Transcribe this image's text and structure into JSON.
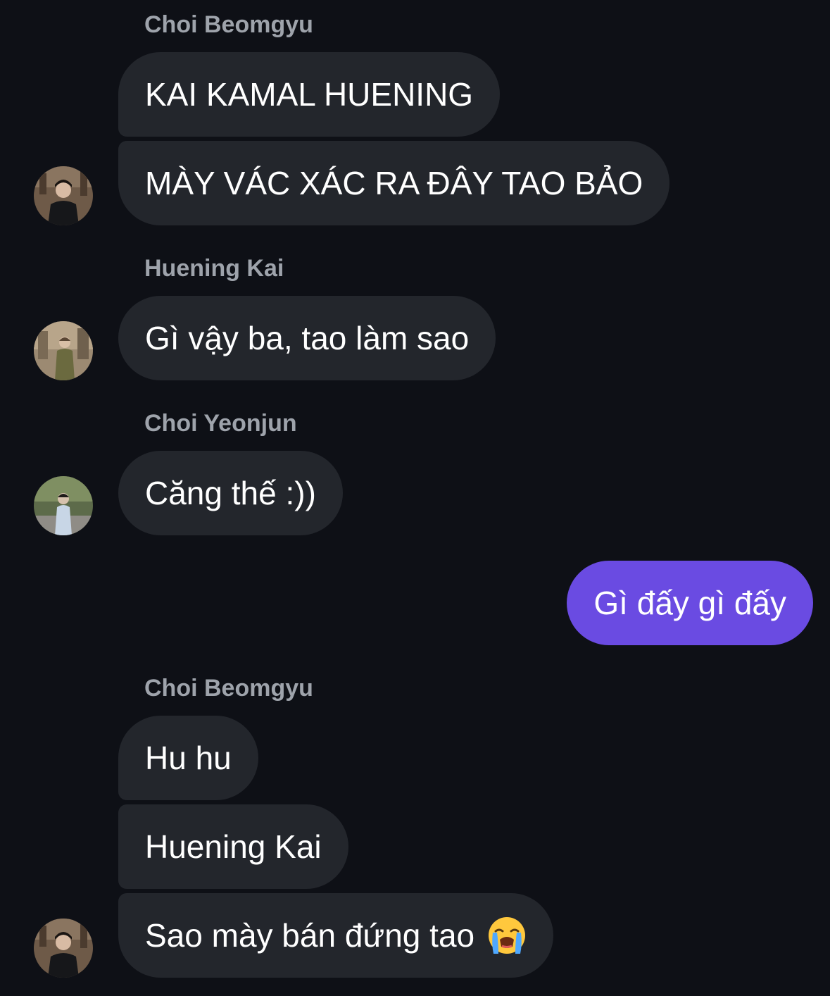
{
  "conversation": {
    "group1": {
      "sender": "Choi Beomgyu",
      "messages": [
        "KAI KAMAL HUENING",
        "MÀY VÁC XÁC RA ĐÂY TAO BẢO"
      ],
      "avatar_icon": "beomgyu-avatar"
    },
    "group2": {
      "sender": "Huening Kai",
      "messages": [
        "Gì vậy ba, tao làm sao"
      ],
      "avatar_icon": "hueningkai-avatar"
    },
    "group3": {
      "sender": "Choi Yeonjun",
      "messages": [
        "Căng thế :))"
      ],
      "avatar_icon": "yeonjun-avatar"
    },
    "outgoing": {
      "messages": [
        "Gì đấy gì đấy"
      ]
    },
    "group4": {
      "sender": "Choi Beomgyu",
      "messages": [
        "Hu hu",
        "Huening Kai",
        "Sao mày bán đứng tao"
      ],
      "emoji": "loudly-crying-face-icon",
      "avatar_icon": "beomgyu-avatar"
    }
  },
  "colors": {
    "background": "#0e1016",
    "incoming_bubble": "#23262c",
    "outgoing_bubble": "#6a4be2",
    "sender_name": "#9ea3ab",
    "message_text": "#ffffff"
  }
}
